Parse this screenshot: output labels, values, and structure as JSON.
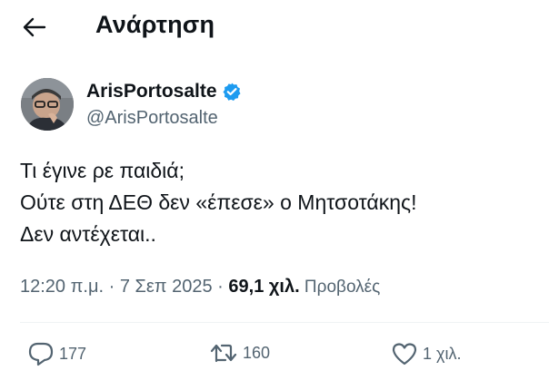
{
  "header": {
    "title": "Ανάρτηση",
    "back_icon": "arrow-left-icon"
  },
  "author": {
    "display_name": "ArisPortosalte",
    "handle": "@ArisPortosalte",
    "verified_icon": "verified-badge-icon",
    "verified_color": "#1d9bf0"
  },
  "tweet": {
    "lines": [
      "Τι έγινε ρε παιδιά;",
      "Ούτε στη ΔΕΘ δεν «έπεσε» ο Μητσοτάκης!",
      "Δεν αντέχεται.."
    ]
  },
  "meta": {
    "time_date": "12:20 π.μ. · 7 Σεπ 2025 · ",
    "views_count": "69,1 χιλ.",
    "views_label": " Προβολές"
  },
  "actions": {
    "replies": "177",
    "reposts": "160",
    "likes": "1 χιλ."
  },
  "colors": {
    "text": "#0f1419",
    "secondary": "#536471",
    "accent": "#1d9bf0"
  }
}
